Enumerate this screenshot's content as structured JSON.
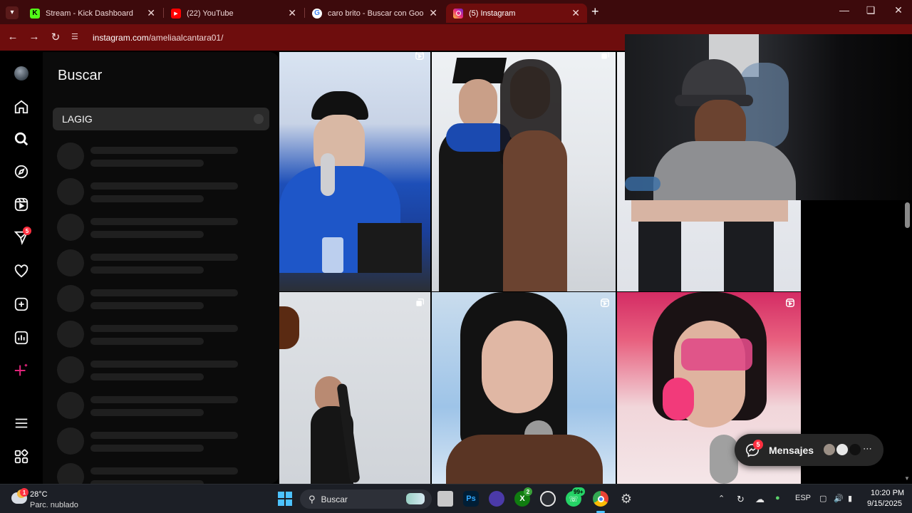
{
  "browser": {
    "tabs": [
      {
        "title": "Stream - Kick Dashboard",
        "favicon": "kick-icon",
        "active": false
      },
      {
        "title": "(22) YouTube",
        "favicon": "youtube-icon",
        "active": false
      },
      {
        "title": "caro brito - Buscar con Google",
        "favicon": "google-icon",
        "active": false
      },
      {
        "title": "(5) Instagram",
        "favicon": "instagram-icon",
        "active": true
      }
    ],
    "new_tab_label": "+",
    "url_host": "instagram.com",
    "url_path": "/ameliaalcantara01/"
  },
  "instagram": {
    "nav": {
      "notifications_badge": "5"
    },
    "search": {
      "title": "Buscar",
      "query": "LAGIG",
      "skeleton_rows": 10
    },
    "messages": {
      "label": "Mensajes",
      "badge": "5"
    }
  },
  "taskbar": {
    "weather_temp": "28°C",
    "weather_desc": "Parc. nublado",
    "weather_badge": "1",
    "search_label": "Buscar",
    "xbox_badge": "2",
    "whatsapp_badge": "99+",
    "language": "ESP",
    "time": "10:20 PM",
    "date": "9/15/2025"
  },
  "colors": {
    "chrome_tabbar": "#3d0a0c",
    "chrome_toolbar": "#6e0d0d",
    "ig_badge": "#ff3040",
    "panel_bg": "#0b0b0b"
  }
}
